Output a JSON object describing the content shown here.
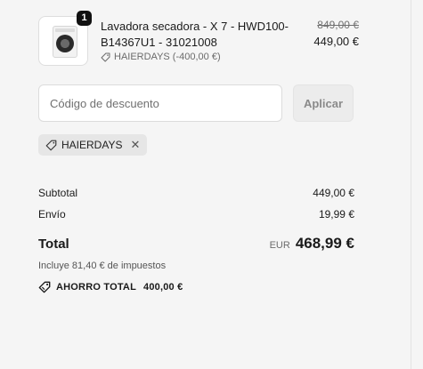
{
  "cart": {
    "item": {
      "quantity": "1",
      "title": "Lavadora secadora - X 7 - HWD100-B14367U1 - 31021008",
      "discount_line": "HAIERDAYS (-400,00 €)",
      "price_original": "849,00 €",
      "price_current": "449,00 €",
      "thumbnail_icon": "washer-dryer-image"
    }
  },
  "discount": {
    "placeholder": "Código de descuento",
    "apply_label": "Aplicar",
    "applied_code": "HAIERDAYS"
  },
  "summary": {
    "subtotal_label": "Subtotal",
    "subtotal_value": "449,00 €",
    "shipping_label": "Envío",
    "shipping_value": "19,99 €",
    "total_label": "Total",
    "currency": "EUR",
    "total_value": "468,99 €",
    "taxes_note": "Incluye 81,40 € de impuestos",
    "savings_label": "AHORRO TOTAL",
    "savings_value": "400,00 €"
  },
  "colors": {
    "background": "#f5f5f5",
    "text": "#1a1a1a",
    "muted": "#6b6b6b",
    "chip": "#e6e6e6"
  }
}
